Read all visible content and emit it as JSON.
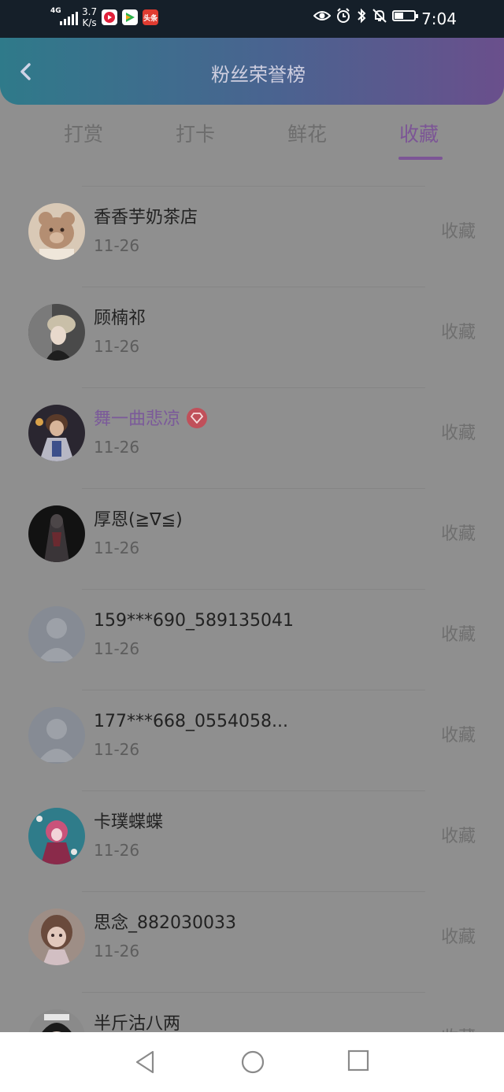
{
  "status_bar": {
    "network": "4G",
    "speed_value": "3.7",
    "speed_unit": "K/s",
    "app_icons": [
      {
        "name": "video-app",
        "color": "#e0203a"
      },
      {
        "name": "green-app",
        "color": "#2bb24c"
      },
      {
        "name": "toutiao-app",
        "label": "头条",
        "color": "#e03c31"
      }
    ],
    "time": "7:04",
    "battery_level": 0.45
  },
  "header": {
    "title": "粉丝荣誉榜"
  },
  "tabs": [
    {
      "label": "打赏",
      "active": false
    },
    {
      "label": "打卡",
      "active": false
    },
    {
      "label": "鲜花",
      "active": false
    },
    {
      "label": "收藏",
      "active": true
    }
  ],
  "fans": [
    {
      "name": "香香芋奶茶店",
      "date": "11-26",
      "action": "收藏",
      "avatar": "bear",
      "vip": false
    },
    {
      "name": "顾楠祁",
      "date": "11-26",
      "action": "收藏",
      "avatar": "hat-person",
      "vip": false
    },
    {
      "name": "舞一曲悲凉",
      "date": "11-26",
      "action": "收藏",
      "avatar": "anime-hero",
      "vip": true
    },
    {
      "name": "厚恩(≧∇≦)",
      "date": "11-26",
      "action": "收藏",
      "avatar": "dark-figure",
      "vip": false
    },
    {
      "name": "159***690_589135041",
      "date": "11-26",
      "action": "收藏",
      "avatar": "default",
      "vip": false
    },
    {
      "name": "177***668_0554058...",
      "date": "11-26",
      "action": "收藏",
      "avatar": "default",
      "vip": false
    },
    {
      "name": "卡璞蝶蝶",
      "date": "11-26",
      "action": "收藏",
      "avatar": "anime-pink",
      "vip": false
    },
    {
      "name": "思念_882030033",
      "date": "11-26",
      "action": "收藏",
      "avatar": "anime-girl",
      "vip": false
    },
    {
      "name": "半斤沽八两",
      "date": "",
      "action": "收藏",
      "avatar": "doll",
      "vip": false
    }
  ],
  "colors": {
    "accent": "#7c5596",
    "header_gradient_start": "#2f7a8a",
    "header_gradient_end": "#6a4f8c",
    "overlay_background": "#8f8f8f"
  }
}
